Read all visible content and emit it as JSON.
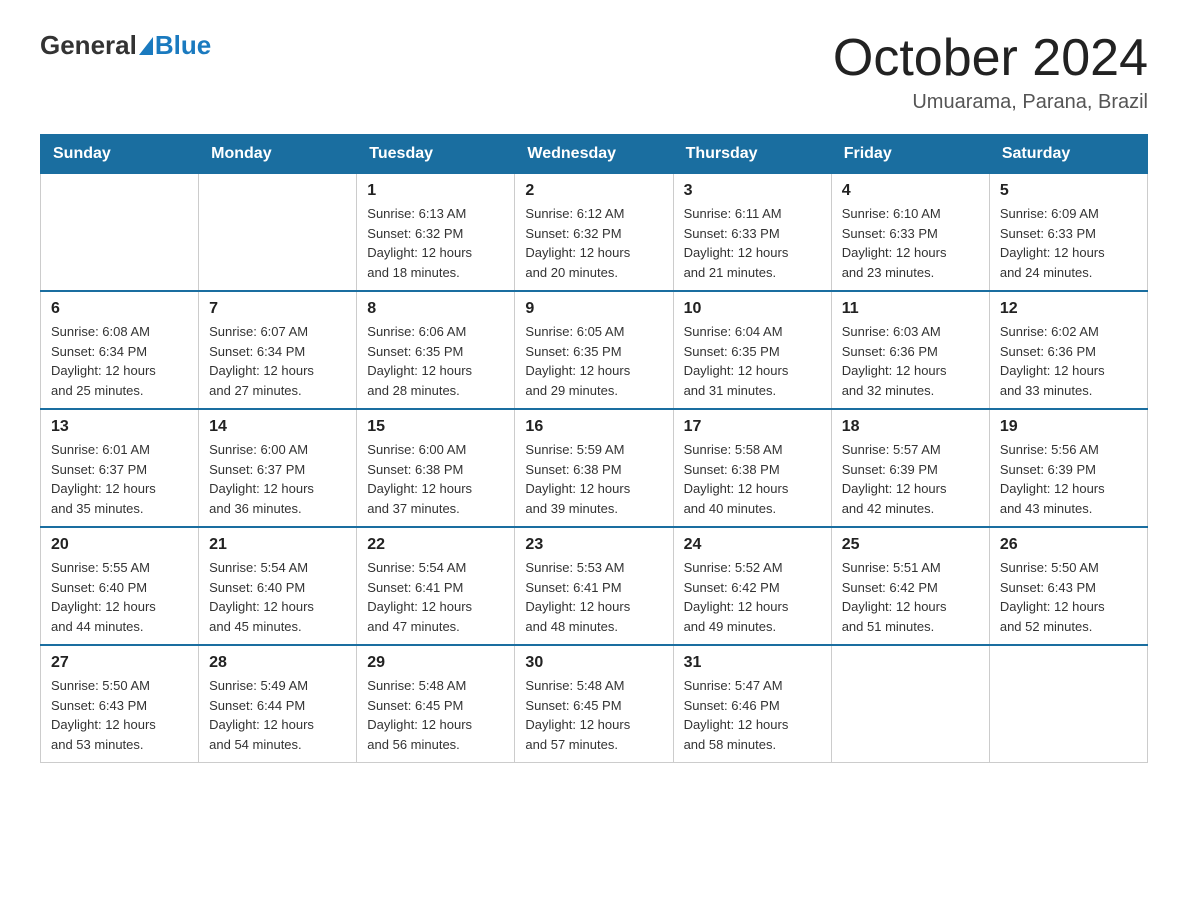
{
  "logo": {
    "general": "General",
    "blue": "Blue"
  },
  "header": {
    "month": "October 2024",
    "location": "Umuarama, Parana, Brazil"
  },
  "days_of_week": [
    "Sunday",
    "Monday",
    "Tuesday",
    "Wednesday",
    "Thursday",
    "Friday",
    "Saturday"
  ],
  "weeks": [
    [
      {
        "day": "",
        "info": ""
      },
      {
        "day": "",
        "info": ""
      },
      {
        "day": "1",
        "info": "Sunrise: 6:13 AM\nSunset: 6:32 PM\nDaylight: 12 hours\nand 18 minutes."
      },
      {
        "day": "2",
        "info": "Sunrise: 6:12 AM\nSunset: 6:32 PM\nDaylight: 12 hours\nand 20 minutes."
      },
      {
        "day": "3",
        "info": "Sunrise: 6:11 AM\nSunset: 6:33 PM\nDaylight: 12 hours\nand 21 minutes."
      },
      {
        "day": "4",
        "info": "Sunrise: 6:10 AM\nSunset: 6:33 PM\nDaylight: 12 hours\nand 23 minutes."
      },
      {
        "day": "5",
        "info": "Sunrise: 6:09 AM\nSunset: 6:33 PM\nDaylight: 12 hours\nand 24 minutes."
      }
    ],
    [
      {
        "day": "6",
        "info": "Sunrise: 6:08 AM\nSunset: 6:34 PM\nDaylight: 12 hours\nand 25 minutes."
      },
      {
        "day": "7",
        "info": "Sunrise: 6:07 AM\nSunset: 6:34 PM\nDaylight: 12 hours\nand 27 minutes."
      },
      {
        "day": "8",
        "info": "Sunrise: 6:06 AM\nSunset: 6:35 PM\nDaylight: 12 hours\nand 28 minutes."
      },
      {
        "day": "9",
        "info": "Sunrise: 6:05 AM\nSunset: 6:35 PM\nDaylight: 12 hours\nand 29 minutes."
      },
      {
        "day": "10",
        "info": "Sunrise: 6:04 AM\nSunset: 6:35 PM\nDaylight: 12 hours\nand 31 minutes."
      },
      {
        "day": "11",
        "info": "Sunrise: 6:03 AM\nSunset: 6:36 PM\nDaylight: 12 hours\nand 32 minutes."
      },
      {
        "day": "12",
        "info": "Sunrise: 6:02 AM\nSunset: 6:36 PM\nDaylight: 12 hours\nand 33 minutes."
      }
    ],
    [
      {
        "day": "13",
        "info": "Sunrise: 6:01 AM\nSunset: 6:37 PM\nDaylight: 12 hours\nand 35 minutes."
      },
      {
        "day": "14",
        "info": "Sunrise: 6:00 AM\nSunset: 6:37 PM\nDaylight: 12 hours\nand 36 minutes."
      },
      {
        "day": "15",
        "info": "Sunrise: 6:00 AM\nSunset: 6:38 PM\nDaylight: 12 hours\nand 37 minutes."
      },
      {
        "day": "16",
        "info": "Sunrise: 5:59 AM\nSunset: 6:38 PM\nDaylight: 12 hours\nand 39 minutes."
      },
      {
        "day": "17",
        "info": "Sunrise: 5:58 AM\nSunset: 6:38 PM\nDaylight: 12 hours\nand 40 minutes."
      },
      {
        "day": "18",
        "info": "Sunrise: 5:57 AM\nSunset: 6:39 PM\nDaylight: 12 hours\nand 42 minutes."
      },
      {
        "day": "19",
        "info": "Sunrise: 5:56 AM\nSunset: 6:39 PM\nDaylight: 12 hours\nand 43 minutes."
      }
    ],
    [
      {
        "day": "20",
        "info": "Sunrise: 5:55 AM\nSunset: 6:40 PM\nDaylight: 12 hours\nand 44 minutes."
      },
      {
        "day": "21",
        "info": "Sunrise: 5:54 AM\nSunset: 6:40 PM\nDaylight: 12 hours\nand 45 minutes."
      },
      {
        "day": "22",
        "info": "Sunrise: 5:54 AM\nSunset: 6:41 PM\nDaylight: 12 hours\nand 47 minutes."
      },
      {
        "day": "23",
        "info": "Sunrise: 5:53 AM\nSunset: 6:41 PM\nDaylight: 12 hours\nand 48 minutes."
      },
      {
        "day": "24",
        "info": "Sunrise: 5:52 AM\nSunset: 6:42 PM\nDaylight: 12 hours\nand 49 minutes."
      },
      {
        "day": "25",
        "info": "Sunrise: 5:51 AM\nSunset: 6:42 PM\nDaylight: 12 hours\nand 51 minutes."
      },
      {
        "day": "26",
        "info": "Sunrise: 5:50 AM\nSunset: 6:43 PM\nDaylight: 12 hours\nand 52 minutes."
      }
    ],
    [
      {
        "day": "27",
        "info": "Sunrise: 5:50 AM\nSunset: 6:43 PM\nDaylight: 12 hours\nand 53 minutes."
      },
      {
        "day": "28",
        "info": "Sunrise: 5:49 AM\nSunset: 6:44 PM\nDaylight: 12 hours\nand 54 minutes."
      },
      {
        "day": "29",
        "info": "Sunrise: 5:48 AM\nSunset: 6:45 PM\nDaylight: 12 hours\nand 56 minutes."
      },
      {
        "day": "30",
        "info": "Sunrise: 5:48 AM\nSunset: 6:45 PM\nDaylight: 12 hours\nand 57 minutes."
      },
      {
        "day": "31",
        "info": "Sunrise: 5:47 AM\nSunset: 6:46 PM\nDaylight: 12 hours\nand 58 minutes."
      },
      {
        "day": "",
        "info": ""
      },
      {
        "day": "",
        "info": ""
      }
    ]
  ]
}
